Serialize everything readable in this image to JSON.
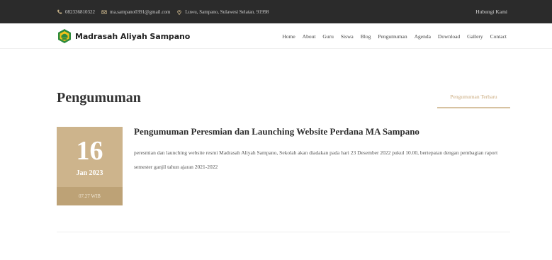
{
  "topbar": {
    "phone": "082336810322",
    "email": "ma.sampano0391@gmail.com",
    "address": "Luwu, Sampano, Sulawesi Selatan. 91998",
    "contact_link": "Hubungi Kami",
    "icon_color": "#c9b48a"
  },
  "navbar": {
    "brand": "Madrasah Aliyah Sampano",
    "menu": [
      "Home",
      "About",
      "Guru",
      "Siswa",
      "Blog",
      "Pengumuman",
      "Agenda",
      "Download",
      "Gallery",
      "Contact"
    ]
  },
  "page": {
    "title": "Pengumuman",
    "latest_label": "Pengumuman Terbaru"
  },
  "announcement": {
    "day": "16",
    "month_year": "Jan 2023",
    "time": "07.27 WIB",
    "title": "Pengumuman Peresmian dan Launching Website Perdana MA Sampano",
    "body": "peresmian dan launching website resmi Madrasah Aliyah Sampano, Sekolah akan diadakan pada hari 23 Desember 2022 pukul 10.00, bertepatan dengan pembagian raport semester ganjil tahun ajaran 2021-2022"
  },
  "colors": {
    "accent": "#cdb48c",
    "accent_dark": "#bda276",
    "topbar_bg": "#2b2b2b"
  }
}
